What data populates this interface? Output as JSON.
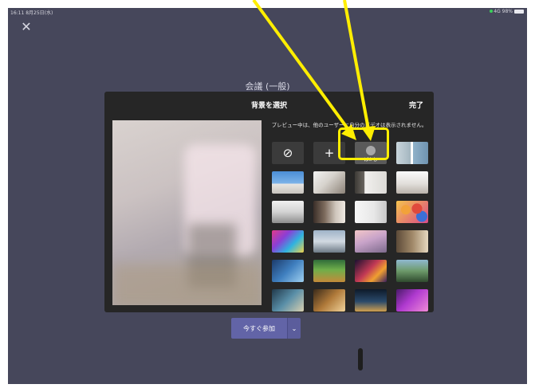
{
  "status": {
    "time": "16:11",
    "date": "8月25日(水)",
    "network": "4G",
    "battery": "98%"
  },
  "meeting_title": "会議 (一般)",
  "dialog": {
    "title": "背景を選択",
    "done": "完了",
    "notice": "プレビュー中は、他のユーザーに自分のビデオは表示されません。",
    "none_icon": "⊘",
    "add_icon": "+",
    "blur_label": "ぼかし"
  },
  "join": {
    "label": "今すぐ参加",
    "dropdown_icon": "chevron-down-icon"
  },
  "colors": {
    "highlight": "#ffee00",
    "screen_bg": "#46475b",
    "dialog_bg": "#262626",
    "join_bg": "#6264a7"
  },
  "backgrounds": [
    "office-window",
    "bright-room",
    "modern-loft",
    "white-kitchen",
    "white-living-room",
    "shelved-room",
    "white-gallery",
    "balloons",
    "colorful-pixels",
    "bridge",
    "mountain-pastel",
    "cozy-library",
    "blue-fantasy",
    "green-game-world",
    "neon-night-city",
    "canyon-valley",
    "sci-fi-street",
    "lamp-lit-room",
    "night-city-bridge",
    "purple-flowers"
  ]
}
